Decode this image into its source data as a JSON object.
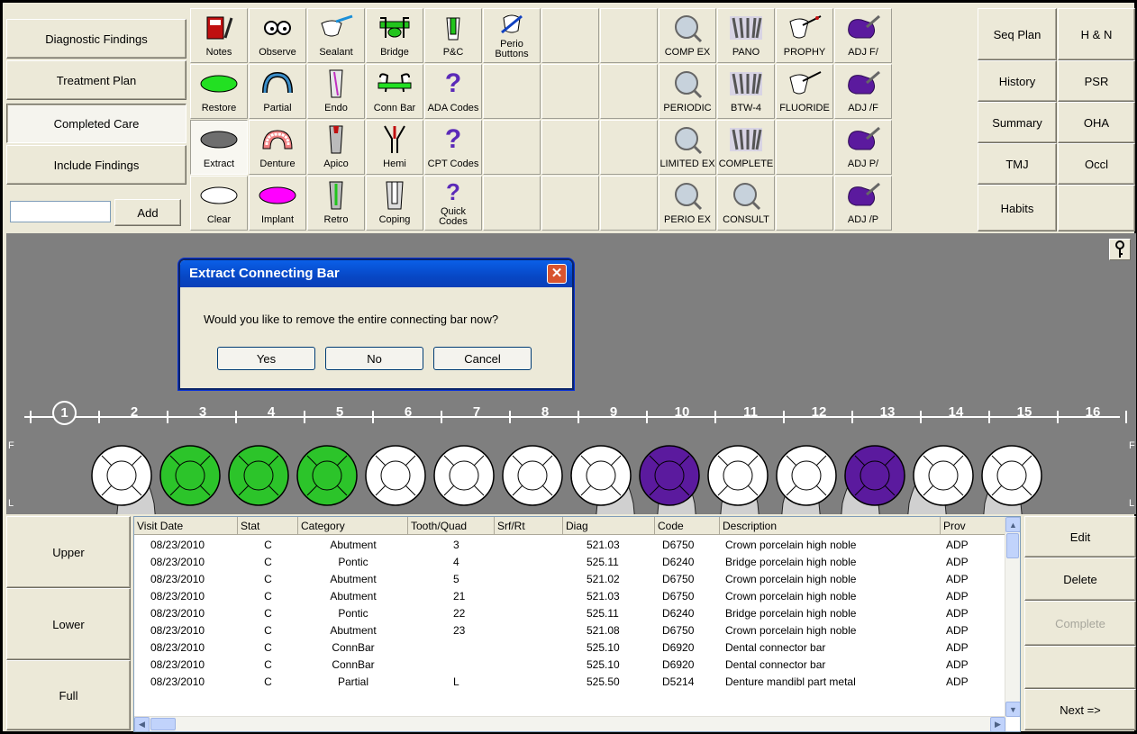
{
  "sections": {
    "diagnostic": "Diagnostic Findings",
    "treatment": "Treatment Plan",
    "completed": "Completed Care",
    "include": "Include Findings",
    "add_value": "",
    "add_label": "Add"
  },
  "tools": {
    "notes": "Notes",
    "observe": "Observe",
    "sealant": "Sealant",
    "bridge": "Bridge",
    "pc": "P&C",
    "perio_buttons": "Perio\nButtons",
    "comp_ex": "COMP EX",
    "pano": "PANO",
    "prophy": "PROPHY",
    "adj1": "ADJ F/",
    "restore": "Restore",
    "partial": "Partial",
    "endo": "Endo",
    "connbar": "Conn Bar",
    "ada": "ADA Codes",
    "periodic": "PERIODIC",
    "btw4": "BTW-4",
    "fluoride": "FLUORIDE",
    "adj2": "ADJ /F",
    "extract": "Extract",
    "denture": "Denture",
    "apico": "Apico",
    "hemi": "Hemi",
    "cpt": "CPT Codes",
    "limited": "LIMITED EX",
    "complete": "COMPLETE",
    "adj3": "ADJ P/",
    "clear": "Clear",
    "implant": "Implant",
    "retro": "Retro",
    "coping": "Coping",
    "quick": "Quick\nCodes",
    "perio_ex": "PERIO EX",
    "consult": "CONSULT",
    "adj4": "ADJ /P"
  },
  "right_buttons": {
    "seq_plan": "Seq Plan",
    "hn": "H & N",
    "history": "History",
    "psr": "PSR",
    "summary": "Summary",
    "oha": "OHA",
    "tmj": "TMJ",
    "occl": "Occl",
    "habits": "Habits"
  },
  "chart": {
    "tooth_numbers": [
      "1",
      "2",
      "3",
      "4",
      "5",
      "6",
      "7",
      "8",
      "9",
      "10",
      "11",
      "12",
      "13",
      "14",
      "15",
      "16"
    ],
    "facial_letter": "F",
    "lingual_letter": "L"
  },
  "dialog": {
    "title": "Extract Connecting Bar",
    "message": "Would you like to remove the entire connecting bar now?",
    "yes": "Yes",
    "no": "No",
    "cancel": "Cancel",
    "close": "✕"
  },
  "arch_buttons": {
    "upper": "Upper",
    "lower": "Lower",
    "full": "Full"
  },
  "action_buttons": {
    "edit": "Edit",
    "delete": "Delete",
    "complete": "Complete",
    "next": "Next =>"
  },
  "table": {
    "headers": [
      "Visit Date",
      "Stat",
      "Category",
      "Tooth/Quad",
      "Srf/Rt",
      "Diag",
      "Code",
      "Description",
      "Prov"
    ],
    "rows": [
      [
        "08/23/2010",
        "C",
        "Abutment",
        "3",
        "",
        "521.03",
        "D6750",
        "Crown porcelain high noble",
        "ADP"
      ],
      [
        "08/23/2010",
        "C",
        "Pontic",
        "4",
        "",
        "525.11",
        "D6240",
        "Bridge porcelain high noble",
        "ADP"
      ],
      [
        "08/23/2010",
        "C",
        "Abutment",
        "5",
        "",
        "521.02",
        "D6750",
        "Crown porcelain high noble",
        "ADP"
      ],
      [
        "08/23/2010",
        "C",
        "Abutment",
        "21",
        "",
        "521.03",
        "D6750",
        "Crown porcelain high noble",
        "ADP"
      ],
      [
        "08/23/2010",
        "C",
        "Pontic",
        "22",
        "",
        "525.11",
        "D6240",
        "Bridge porcelain high noble",
        "ADP"
      ],
      [
        "08/23/2010",
        "C",
        "Abutment",
        "23",
        "",
        "521.08",
        "D6750",
        "Crown porcelain high noble",
        "ADP"
      ],
      [
        "08/23/2010",
        "C",
        "ConnBar",
        "",
        "",
        "525.10",
        "D6920",
        "Dental connector bar",
        "ADP"
      ],
      [
        "08/23/2010",
        "C",
        "ConnBar",
        "",
        "",
        "525.10",
        "D6920",
        "Dental connector bar",
        "ADP"
      ],
      [
        "08/23/2010",
        "C",
        "Partial",
        "L",
        "",
        "525.50",
        "D5214",
        "Denture mandibl part metal",
        "ADP"
      ]
    ]
  },
  "colors": {
    "chart_bg": "#7f7f7f",
    "green": "#22c41c",
    "purple": "#5b1a9e",
    "title_blue": "#0a5fe8"
  }
}
